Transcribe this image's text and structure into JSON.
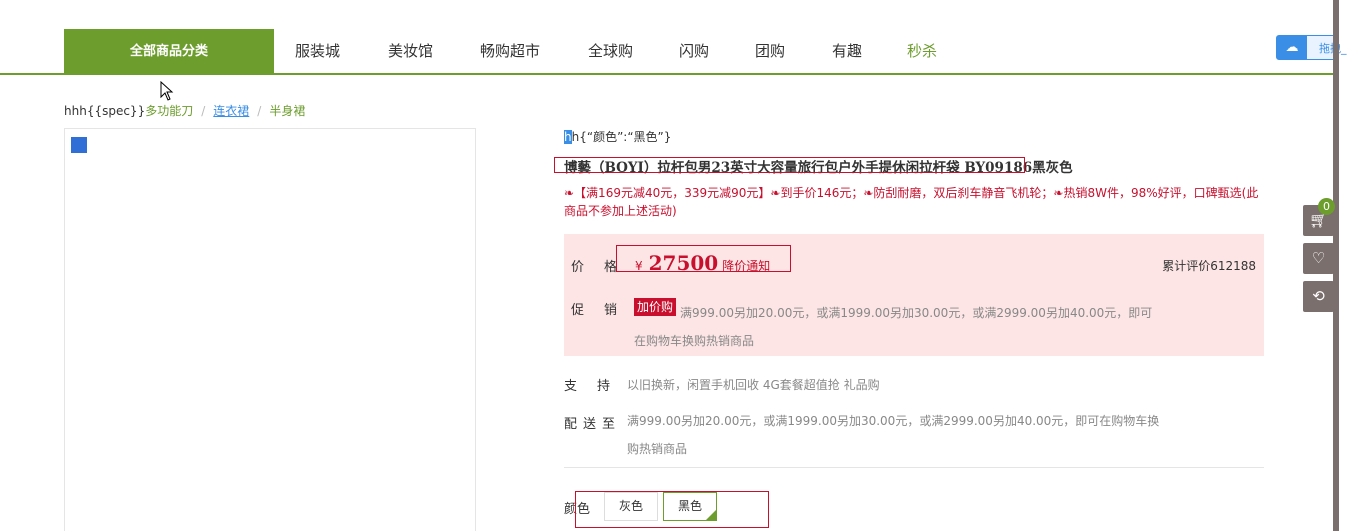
{
  "nav": {
    "all_categories": "全部商品分类",
    "items": [
      "服装城",
      "美妆馆",
      "畅购超市",
      "全球购",
      "闪购",
      "团购",
      "有趣",
      "秒杀"
    ]
  },
  "float_widget": {
    "text": "拖拽_"
  },
  "side_tools": {
    "cart_count": "0"
  },
  "breadcrumb": {
    "prefix": "hhh{{spec}}",
    "level1": "多功能刀",
    "level2": "连衣裙",
    "level3": "半身裙",
    "separator": "/"
  },
  "product": {
    "spec_mark": "h",
    "spec_rest": "h{“颜色”:“黑色”}",
    "title": "博藝（BOYI）拉杆包男23英寸大容量旅行包户外手提休闲拉杆袋 BY09186黑灰色",
    "promo": "❧【满169元减40元，339元减90元】❧到手价146元；❧防刮耐磨，双后刹车静音飞机轮；❧热销8W件，98%好评，口碑甄选(此商品不参加上述活动)",
    "price_label": "价格",
    "price_symbol": "¥",
    "price": "27500",
    "notify": "降价通知",
    "rating": "累计评价612188",
    "promotion_label": "促销",
    "promotion_tag": "加价购",
    "promotion_desc": "满999.00另加20.00元，或满1999.00另加30.00元，或满2999.00另加40.00元，即可在购物车换购热销商品",
    "support_label": "支持",
    "support_value": "以旧换新，闲置手机回收 4G套餐超值抢 礼品购",
    "delivery_label": "配送至",
    "delivery_value": "满999.00另加20.00元，或满1999.00另加30.00元，或满2999.00另加40.00元，即可在购物车换购热销商品",
    "color_label": "颜色",
    "colors": [
      "灰色",
      "黑色"
    ]
  },
  "colors": {
    "accent": "#6c9d2d",
    "red": "#c8102e",
    "price_bg": "#fde5e5"
  }
}
